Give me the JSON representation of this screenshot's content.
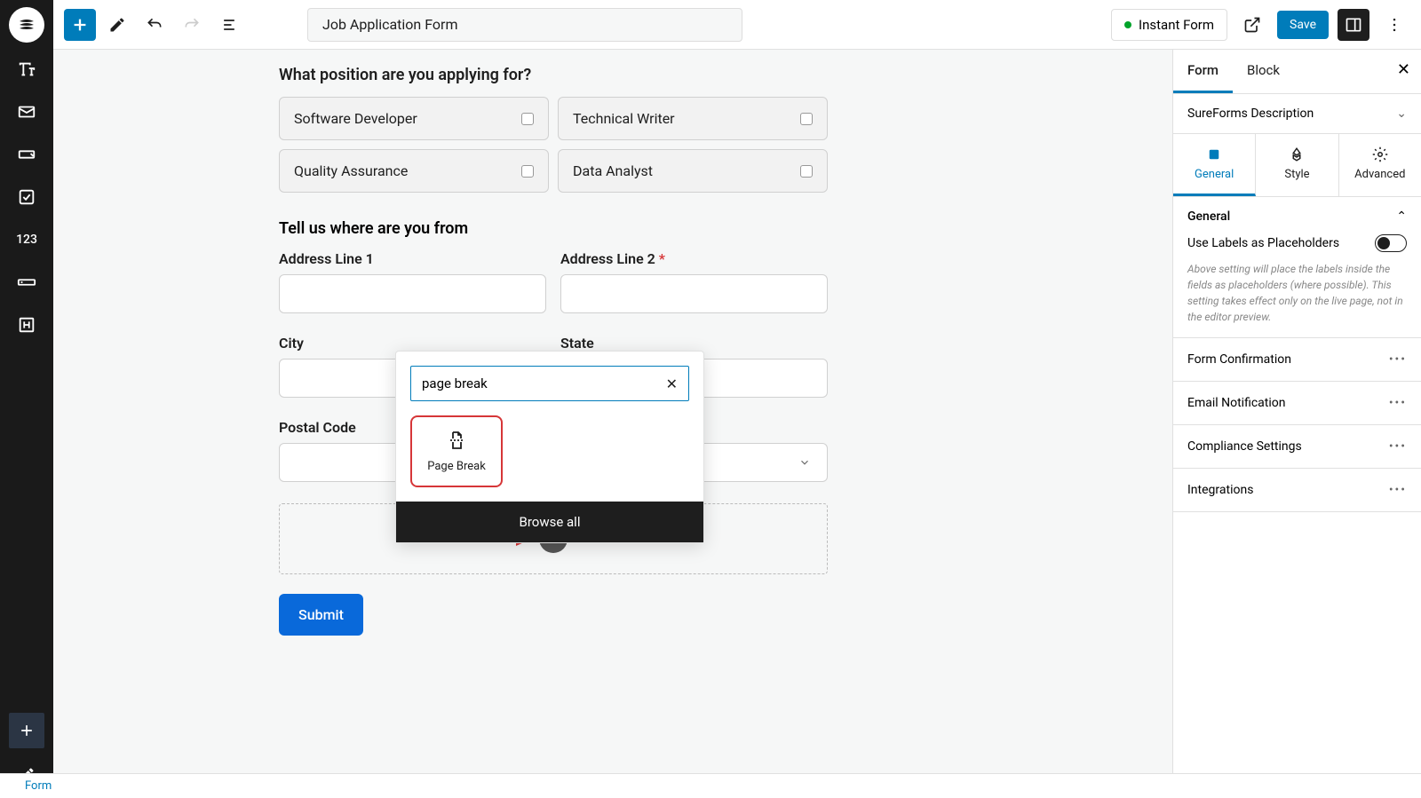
{
  "top": {
    "title": "Job Application Form",
    "instant_form": "Instant Form",
    "save": "Save"
  },
  "left_nav": {
    "text_item": "123"
  },
  "form": {
    "q1": "What position are you applying for?",
    "options": [
      "Software Developer",
      "Technical Writer",
      "Quality Assurance",
      "Data Analyst"
    ],
    "section_title": "Tell us where are you from",
    "addr1": "Address Line 1",
    "addr2": "Address Line 2",
    "city": "City",
    "state": "State",
    "postal": "Postal Code",
    "submit": "Submit"
  },
  "inserter": {
    "search_value": "page break",
    "result_label": "Page Break",
    "browse_all": "Browse all"
  },
  "right": {
    "tab_form": "Form",
    "tab_block": "Block",
    "desc_section": "SureForms Description",
    "subtab_general": "General",
    "subtab_style": "Style",
    "subtab_advanced": "Advanced",
    "general_header": "General",
    "labels_placeholder": "Use Labels as Placeholders",
    "help": "Above setting will place the labels inside the fields as placeholders (where possible). This setting takes effect only on the live page, not in the editor preview.",
    "items": [
      "Form Confirmation",
      "Email Notification",
      "Compliance Settings",
      "Integrations"
    ]
  },
  "breadcrumb": "Form"
}
